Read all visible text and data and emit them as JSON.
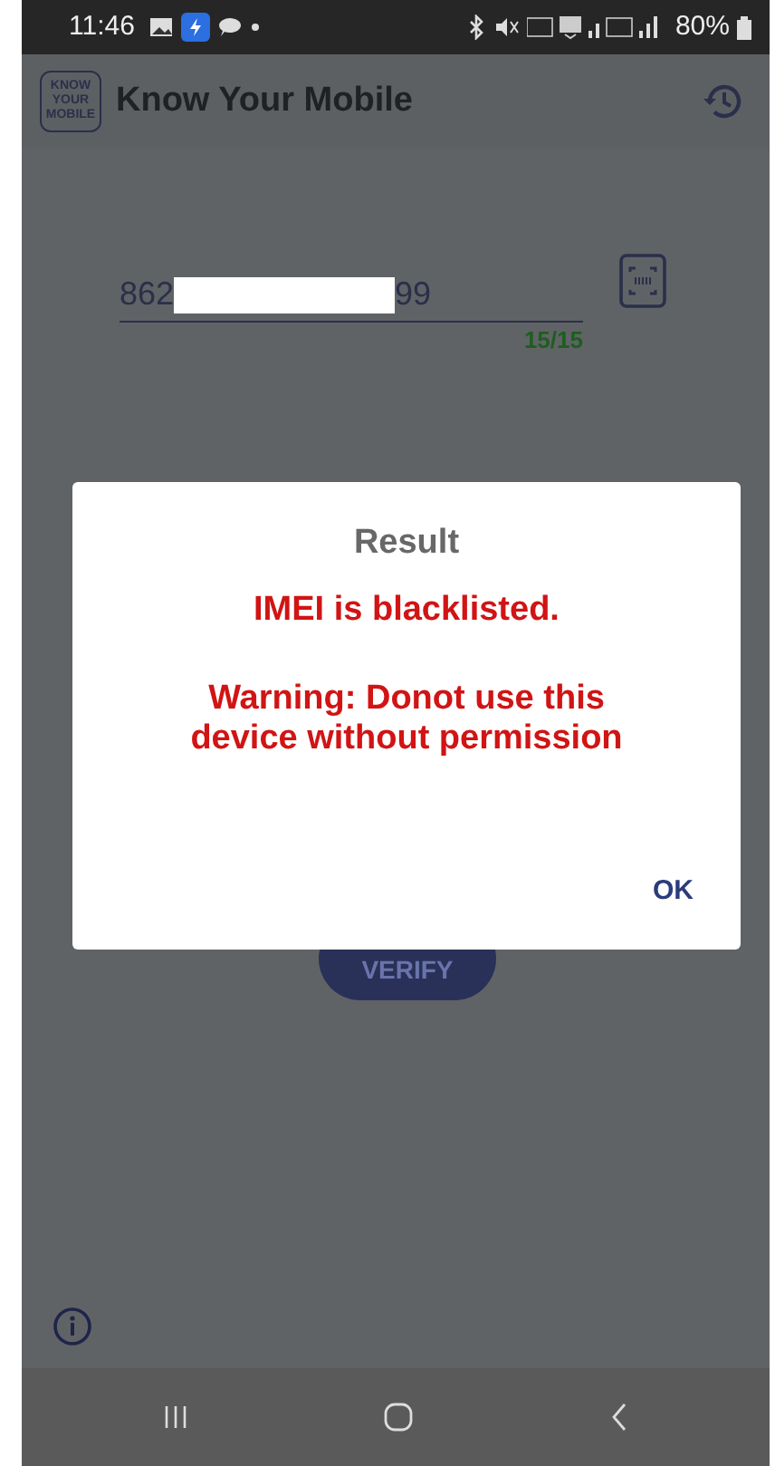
{
  "status_bar": {
    "time": "11:46",
    "battery": "80%"
  },
  "app_bar": {
    "logo_lines": [
      "KNOW",
      "YOUR",
      "MOBILE"
    ],
    "title": "Know Your Mobile"
  },
  "imei_field": {
    "prefix": "862",
    "suffix": "99",
    "counter": "15/15"
  },
  "verify_button": {
    "label": "VERIFY"
  },
  "dialog": {
    "title": "Result",
    "message": "IMEI is blacklisted.",
    "warning": "Warning: Donot use this device without permission",
    "button": "OK"
  }
}
